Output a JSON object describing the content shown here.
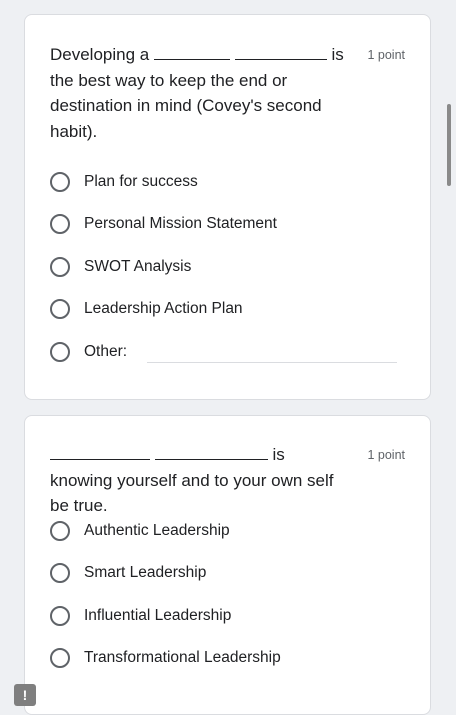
{
  "questions": [
    {
      "text_before": "Developing a",
      "text_after": "is the best way to keep the end or destination in mind (Covey's second habit).",
      "points": "1 point",
      "options": [
        "Plan for success",
        "Personal Mission Statement",
        "SWOT Analysis",
        "Leadership Action Plan",
        "Other:"
      ]
    },
    {
      "text_after": "is knowing yourself and to your own self be true.",
      "points": "1 point",
      "options": [
        "Authentic Leadership",
        "Smart Leadership",
        "Influential Leadership",
        "Transformational Leadership"
      ]
    }
  ],
  "report_icon": "!"
}
